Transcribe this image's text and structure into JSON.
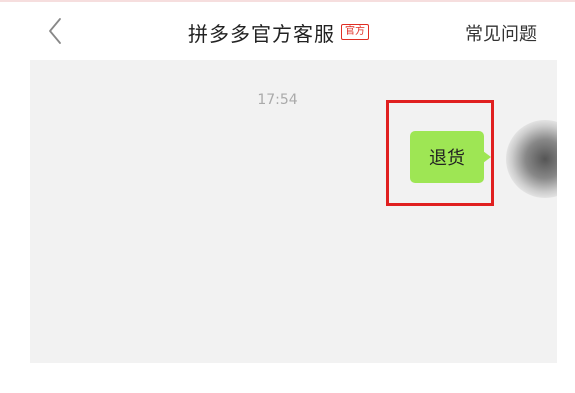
{
  "header": {
    "back_icon": "chevron-left-icon",
    "title": "拼多多官方客服",
    "badge": "官方",
    "faq_label": "常见问题"
  },
  "chat": {
    "timestamp": "17:54",
    "messages": [
      {
        "sender": "user",
        "text": "退货"
      }
    ]
  },
  "colors": {
    "accent": "#e02e24",
    "bubble": "#9ee654",
    "chat_bg": "#f2f2f2",
    "highlight": "#e02020"
  }
}
